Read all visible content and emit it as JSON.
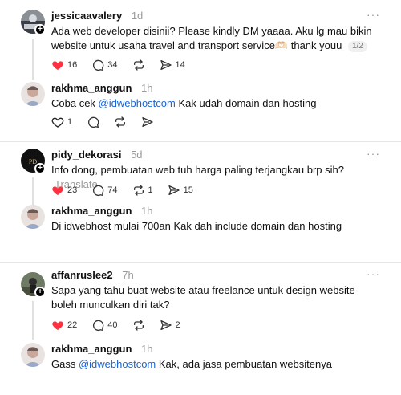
{
  "threads": [
    {
      "post": {
        "username": "jessicaavalery",
        "time": "1d",
        "text": "Ada web developer disinii? Please kindly DM yaaaa. Aku lg mau bikin website untuk usaha travel and transport service🫶🏻 thank youu",
        "pager": "1/2",
        "likes": "16",
        "comments": "34",
        "reposts": "",
        "shares": "14"
      },
      "reply": {
        "username": "rakhma_anggun",
        "time": "1h",
        "text_before": "Coba cek ",
        "mention": "@idwebhostcom",
        "text_after": " Kak udah domain dan hosting",
        "likes": "1",
        "comments": "",
        "reposts": "",
        "shares": ""
      }
    },
    {
      "post": {
        "username": "pidy_dekorasi",
        "time": "5d",
        "text": "Info dong, pembuatan web tuh harga paling terjangkau brp sih?",
        "translate": "Translate",
        "likes": "23",
        "comments": "74",
        "reposts": "1",
        "shares": "15"
      },
      "reply": {
        "username": "rakhma_anggun",
        "time": "1h",
        "text": "Di idwebhost mulai 700an Kak dah include domain dan hosting"
      }
    },
    {
      "post": {
        "username": "affanruslee2",
        "time": "7h",
        "text": "Sapa yang tahu buat website atau freelance untuk design website boleh munculkan diri tak?",
        "likes": "22",
        "comments": "40",
        "reposts": "",
        "shares": "2"
      },
      "reply": {
        "username": "rakhma_anggun",
        "time": "1h",
        "text_before": "Gass ",
        "mention": "@idwebhostcom",
        "text_after": " Kak, ada jasa pembuatan websitenya"
      }
    }
  ],
  "icons": {
    "like_filled_color": "#ff3040",
    "mention_color": "#1a65d6",
    "more": "···"
  }
}
